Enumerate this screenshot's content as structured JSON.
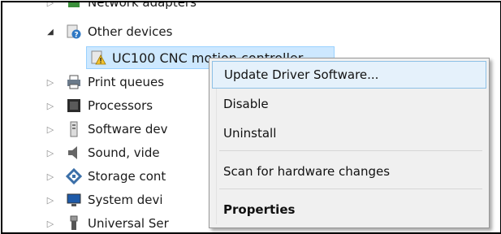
{
  "tree": {
    "partial_top_label": "Network adapters",
    "other_devices_label": "Other devices",
    "selected_device_label": "UC100 CNC motion controller",
    "items": [
      {
        "label": "Print queues",
        "icon": "printer-icon"
      },
      {
        "label": "Processors",
        "icon": "processor-icon"
      },
      {
        "label": "Software dev",
        "icon": "software-device-icon"
      },
      {
        "label": "Sound, vide",
        "icon": "speaker-icon"
      },
      {
        "label": "Storage cont",
        "icon": "storage-controller-icon"
      },
      {
        "label": "System devi",
        "icon": "system-device-icon"
      },
      {
        "label": "Universal Ser",
        "icon": "usb-icon"
      }
    ]
  },
  "context_menu": {
    "update_driver": "Update Driver Software...",
    "disable": "Disable",
    "uninstall": "Uninstall",
    "scan": "Scan for hardware changes",
    "properties": "Properties"
  },
  "colors": {
    "selection_bg": "#cde8ff",
    "menu_bg": "#f0f0f0",
    "menu_hover_bg": "#e5f1fb",
    "menu_hover_border": "#8ec1e6"
  }
}
